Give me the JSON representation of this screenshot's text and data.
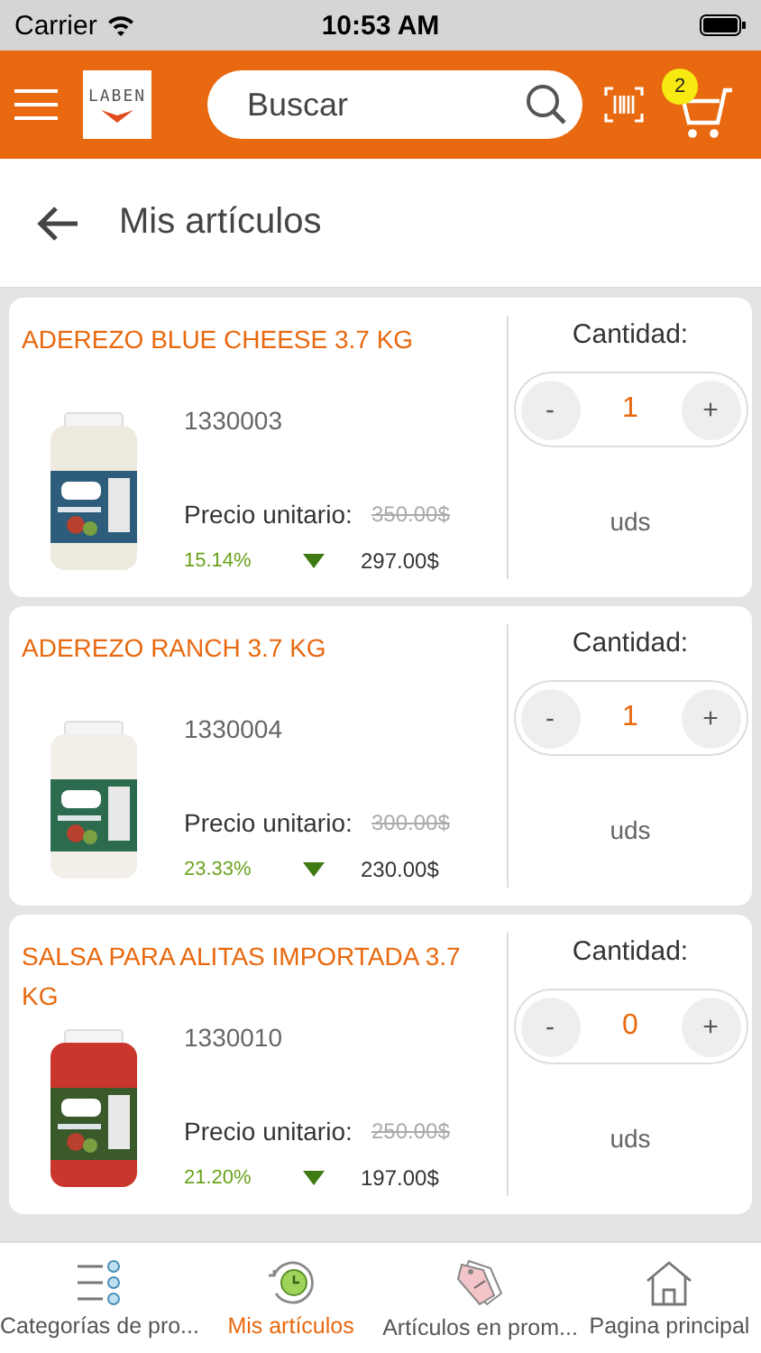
{
  "status_bar": {
    "carrier": "Carrier",
    "time": "10:53 AM"
  },
  "header": {
    "logo": "LABEN",
    "search": {
      "placeholder": "Buscar"
    },
    "cart_count": "2"
  },
  "page": {
    "title": "Mis artículos"
  },
  "products": [
    {
      "name": "ADEREZO BLUE CHEESE 3.7 KG",
      "code": "1330003",
      "price_label": "Precio unitario:",
      "old_price": "350.00$",
      "discount": "15.14%",
      "price": "297.00$",
      "quantity_label": "Cantidad:",
      "minus": "-",
      "quantity": "1",
      "plus": "+",
      "unit": "uds"
    },
    {
      "name": "ADEREZO RANCH 3.7 KG",
      "code": "1330004",
      "price_label": "Precio unitario:",
      "old_price": "300.00$",
      "discount": "23.33%",
      "price": "230.00$",
      "quantity_label": "Cantidad:",
      "minus": "-",
      "quantity": "1",
      "plus": "+",
      "unit": "uds"
    },
    {
      "name": "SALSA PARA ALITAS IMPORTADA 3.7 KG",
      "code": "1330010",
      "price_label": "Precio unitario:",
      "old_price": "250.00$",
      "discount": "21.20%",
      "price": "197.00$",
      "quantity_label": "Cantidad:",
      "minus": "-",
      "quantity": "0",
      "plus": "+",
      "unit": "uds"
    }
  ],
  "bottom_nav": [
    {
      "label": "Categorías de pro...",
      "selected": false
    },
    {
      "label": "Mis artículos",
      "selected": true
    },
    {
      "label": "Artículos en prom...",
      "selected": false
    },
    {
      "label": "Pagina principal",
      "selected": false
    }
  ]
}
